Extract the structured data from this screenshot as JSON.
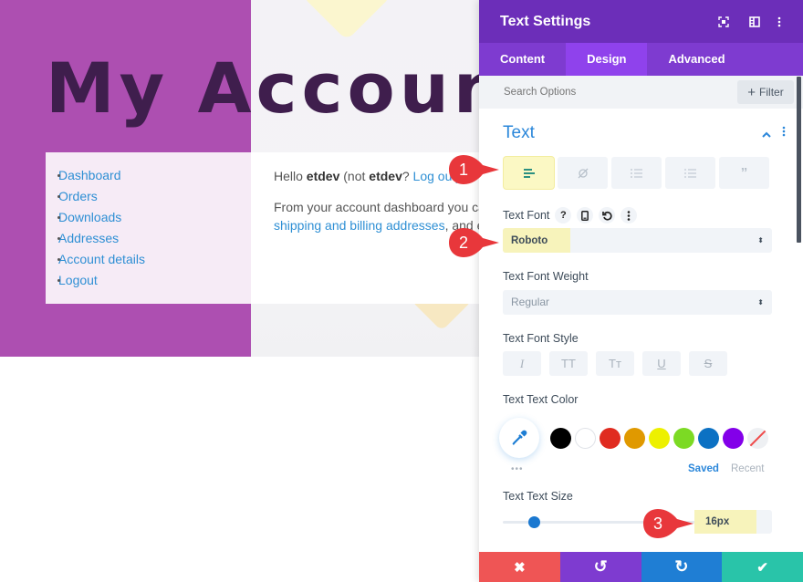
{
  "page": {
    "title": "My Account",
    "nav": [
      {
        "label": "Dashboard"
      },
      {
        "label": "Orders"
      },
      {
        "label": "Downloads"
      },
      {
        "label": "Addresses"
      },
      {
        "label": "Account details"
      },
      {
        "label": "Logout"
      }
    ],
    "greeting": {
      "prefix": "Hello ",
      "user": "etdev",
      "middle": " (not ",
      "user2": "etdev",
      "suffix": "? ",
      "logout_link": "Log out)"
    },
    "dashboard_text": {
      "line1": "From your account dashboard you can view your",
      "link": "shipping and billing addresses",
      "after_link": ", and edit your password"
    },
    "colors": {
      "purple_bg": "#ad4fb1",
      "title_color": "#3f1e4d",
      "link_color": "#2e8fd4"
    }
  },
  "markers": [
    {
      "number": "1",
      "color": "#e8373b"
    },
    {
      "number": "2",
      "color": "#e8373b"
    },
    {
      "number": "3",
      "color": "#e8373b"
    }
  ],
  "panel": {
    "title": "Text Settings",
    "header_icons": [
      "focus-icon",
      "split-view-icon",
      "more-vertical-icon"
    ],
    "tabs": [
      {
        "label": "Content",
        "active": false
      },
      {
        "label": "Design",
        "active": true
      },
      {
        "label": "Advanced",
        "active": false
      }
    ],
    "search": {
      "placeholder": "Search Options",
      "filter_label": "Filter"
    },
    "section": {
      "title": "Text",
      "text_type_buttons": [
        {
          "icon": "paragraph-text-icon",
          "active": true
        },
        {
          "icon": "link-icon",
          "active": false
        },
        {
          "icon": "unordered-list-icon",
          "active": false
        },
        {
          "icon": "ordered-list-icon",
          "active": false
        },
        {
          "icon": "blockquote-icon",
          "active": false
        }
      ],
      "text_font": {
        "label": "Text Font",
        "value": "Roboto",
        "label_icons": [
          "help-icon",
          "responsive-icon",
          "reset-icon",
          "more-vertical-icon"
        ]
      },
      "text_font_weight": {
        "label": "Text Font Weight",
        "value": "Regular"
      },
      "text_font_style": {
        "label": "Text Font Style",
        "buttons": [
          {
            "glyph": "I",
            "icon": "italic-icon"
          },
          {
            "glyph": "TT",
            "icon": "uppercase-icon"
          },
          {
            "glyph": "Tт",
            "icon": "capitalize-icon"
          },
          {
            "glyph": "U",
            "icon": "underline-icon"
          },
          {
            "glyph": "S",
            "icon": "strikethrough-icon"
          }
        ]
      },
      "text_color": {
        "label": "Text Text Color",
        "swatches": [
          "#000000",
          "#ffffff",
          "#e02b20",
          "#e09900",
          "#edf000",
          "#7cda24",
          "#0c71c3",
          "#8300e9",
          "none"
        ],
        "saved_label": "Saved",
        "recent_label": "Recent",
        "more_label": "•••"
      },
      "text_size": {
        "label": "Text Text Size",
        "value": "16px",
        "slider_fraction": 0.16
      }
    },
    "footer": [
      {
        "icon": "close-icon",
        "glyph": "✖",
        "color": "#ef5555"
      },
      {
        "icon": "undo-icon",
        "glyph": "↺",
        "color": "#7e3bd0"
      },
      {
        "icon": "redo-icon",
        "glyph": "↻",
        "color": "#1f7ed4"
      },
      {
        "icon": "check-icon",
        "glyph": "✔",
        "color": "#29c4a9"
      }
    ]
  }
}
